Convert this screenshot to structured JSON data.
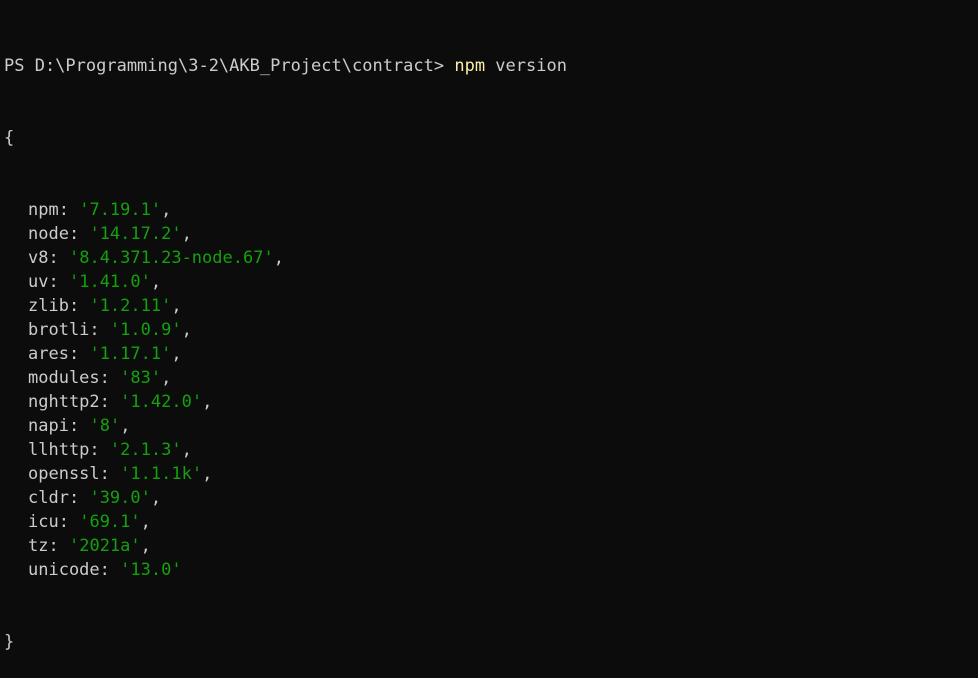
{
  "terminal": {
    "prompt": "PS D:\\Programming\\3-2\\AKB_Project\\contract> ",
    "command": "npm",
    "args": " version",
    "open_brace": "{",
    "close_brace": "}",
    "entries": [
      {
        "key": "npm",
        "value": "7.19.1",
        "trailing": ","
      },
      {
        "key": "node",
        "value": "14.17.2",
        "trailing": ","
      },
      {
        "key": "v8",
        "value": "8.4.371.23-node.67",
        "trailing": ","
      },
      {
        "key": "uv",
        "value": "1.41.0",
        "trailing": ","
      },
      {
        "key": "zlib",
        "value": "1.2.11",
        "trailing": ","
      },
      {
        "key": "brotli",
        "value": "1.0.9",
        "trailing": ","
      },
      {
        "key": "ares",
        "value": "1.17.1",
        "trailing": ","
      },
      {
        "key": "modules",
        "value": "83",
        "trailing": ","
      },
      {
        "key": "nghttp2",
        "value": "1.42.0",
        "trailing": ","
      },
      {
        "key": "napi",
        "value": "8",
        "trailing": ","
      },
      {
        "key": "llhttp",
        "value": "2.1.3",
        "trailing": ","
      },
      {
        "key": "openssl",
        "value": "1.1.1k",
        "trailing": ","
      },
      {
        "key": "cldr",
        "value": "39.0",
        "trailing": ","
      },
      {
        "key": "icu",
        "value": "69.1",
        "trailing": ","
      },
      {
        "key": "tz",
        "value": "2021a",
        "trailing": ","
      },
      {
        "key": "unicode",
        "value": "13.0",
        "trailing": ""
      }
    ]
  },
  "colors": {
    "background": "#0c0c0c",
    "foreground": "#cccccc",
    "command": "#f9f1a5",
    "string": "#13a10e"
  }
}
